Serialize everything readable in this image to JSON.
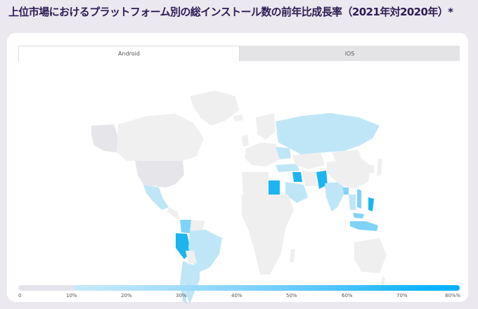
{
  "title": "上位市場におけるプラットフォーム別の総インストール数の前年比成長率（2021年対2020年）*",
  "tabs": [
    {
      "label": "Android",
      "active": true
    },
    {
      "label": "iOS",
      "active": false
    }
  ],
  "map": {
    "no_data_color": "#efefef",
    "growth_colors": {
      "low": "#bfe6f7",
      "mid": "#7fd3f7",
      "high": "#1cb5f0"
    },
    "highlighted_regions": {
      "high": [
        "Pakistan",
        "Egypt",
        "Peru",
        "Philippines",
        "Iraq"
      ],
      "mid": [
        "Indonesia",
        "Bangladesh",
        "Malaysia",
        "Vietnam",
        "Colombia"
      ],
      "low": [
        "Russia",
        "Mexico",
        "Brazil",
        "Argentina",
        "India",
        "Chile",
        "Thailand",
        "Ukraine",
        "Turkey",
        "Saudi Arabia"
      ]
    }
  },
  "legend": {
    "ticks": [
      "0",
      "10%",
      "20%",
      "30%",
      "40%",
      "50%",
      "60%",
      "70%",
      "80%"
    ],
    "max_label": "80%%"
  }
}
